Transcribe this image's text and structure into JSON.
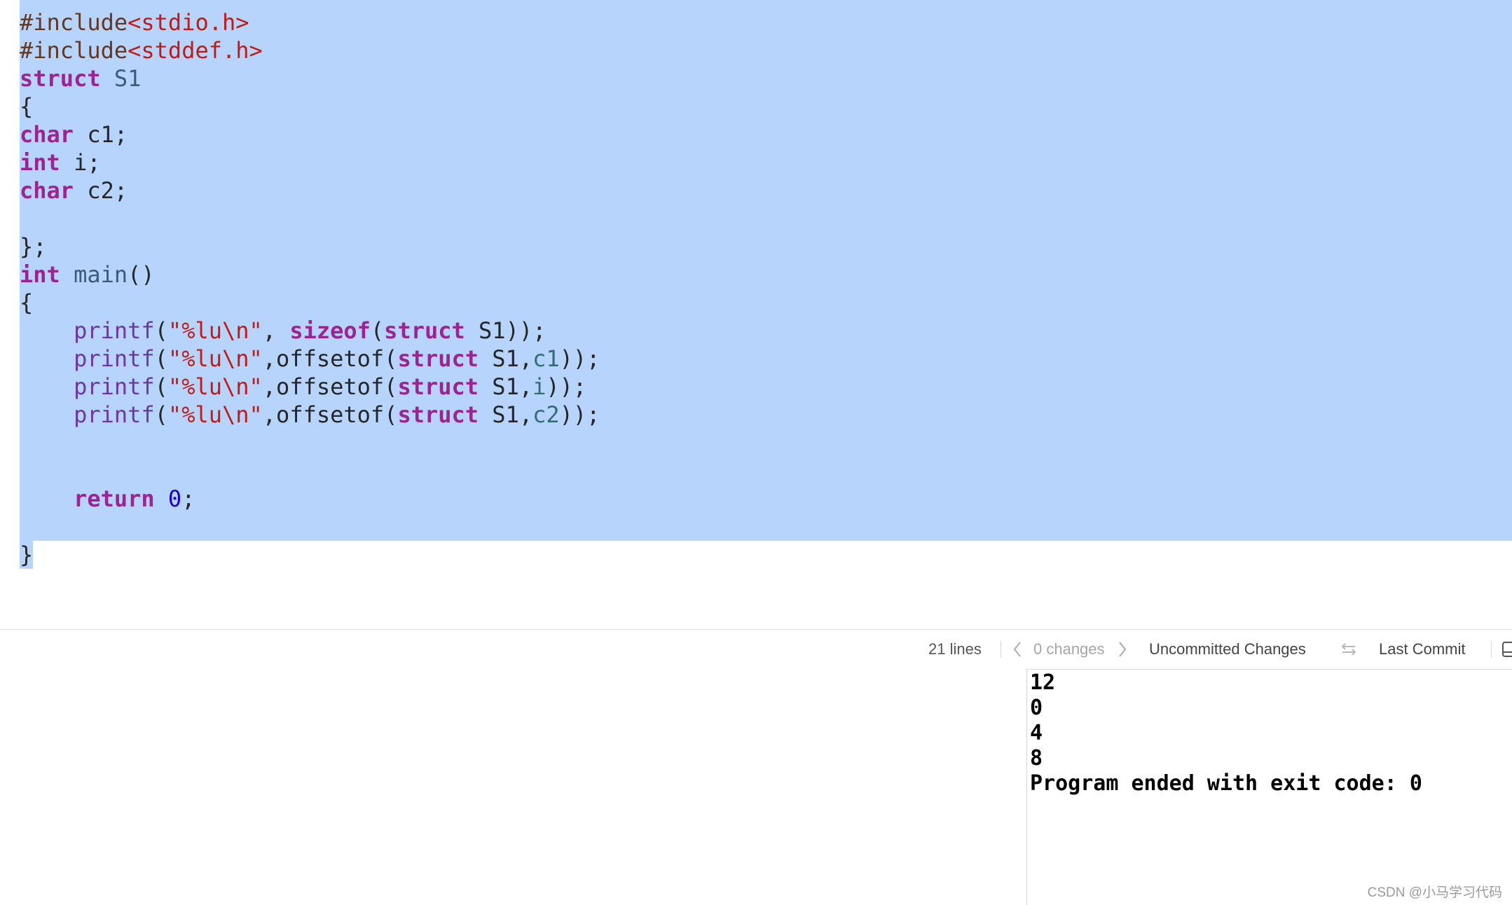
{
  "editor": {
    "lines": [
      {
        "tokens": [
          {
            "t": "#include",
            "c": "pp"
          },
          {
            "t": "<stdio.h>",
            "c": "str"
          }
        ]
      },
      {
        "tokens": [
          {
            "t": "#include",
            "c": "pp"
          },
          {
            "t": "<stddef.h>",
            "c": "str"
          }
        ]
      },
      {
        "tokens": [
          {
            "t": "struct",
            "c": "kw"
          },
          {
            "t": " "
          },
          {
            "t": "S1",
            "c": "type"
          }
        ]
      },
      {
        "tokens": [
          {
            "t": "{"
          }
        ]
      },
      {
        "tokens": [
          {
            "t": "char",
            "c": "kw"
          },
          {
            "t": " c1;"
          }
        ]
      },
      {
        "tokens": [
          {
            "t": "int",
            "c": "kw"
          },
          {
            "t": " i;"
          }
        ]
      },
      {
        "tokens": [
          {
            "t": "char",
            "c": "kw"
          },
          {
            "t": " c2;"
          }
        ]
      },
      {
        "tokens": []
      },
      {
        "tokens": [
          {
            "t": "};"
          }
        ]
      },
      {
        "tokens": [
          {
            "t": "int",
            "c": "kw"
          },
          {
            "t": " "
          },
          {
            "t": "main",
            "c": "type"
          },
          {
            "t": "()"
          }
        ]
      },
      {
        "tokens": [
          {
            "t": "{"
          }
        ]
      },
      {
        "tokens": [
          {
            "t": "    "
          },
          {
            "t": "printf",
            "c": "fn"
          },
          {
            "t": "("
          },
          {
            "t": "\"%lu\\n\"",
            "c": "str"
          },
          {
            "t": ", "
          },
          {
            "t": "sizeof",
            "c": "kw"
          },
          {
            "t": "("
          },
          {
            "t": "struct",
            "c": "kw"
          },
          {
            "t": " S1));"
          }
        ]
      },
      {
        "tokens": [
          {
            "t": "    "
          },
          {
            "t": "printf",
            "c": "fn"
          },
          {
            "t": "("
          },
          {
            "t": "\"%lu\\n\"",
            "c": "str"
          },
          {
            "t": ",offsetof("
          },
          {
            "t": "struct",
            "c": "kw"
          },
          {
            "t": " S1,"
          },
          {
            "t": "c1",
            "c": "mem"
          },
          {
            "t": "));"
          }
        ]
      },
      {
        "tokens": [
          {
            "t": "    "
          },
          {
            "t": "printf",
            "c": "fn"
          },
          {
            "t": "("
          },
          {
            "t": "\"%lu\\n\"",
            "c": "str"
          },
          {
            "t": ",offsetof("
          },
          {
            "t": "struct",
            "c": "kw"
          },
          {
            "t": " S1,"
          },
          {
            "t": "i",
            "c": "mem"
          },
          {
            "t": "));"
          }
        ]
      },
      {
        "tokens": [
          {
            "t": "    "
          },
          {
            "t": "printf",
            "c": "fn"
          },
          {
            "t": "("
          },
          {
            "t": "\"%lu\\n\"",
            "c": "str"
          },
          {
            "t": ",offsetof("
          },
          {
            "t": "struct",
            "c": "kw"
          },
          {
            "t": " S1,"
          },
          {
            "t": "c2",
            "c": "mem"
          },
          {
            "t": "));"
          }
        ]
      },
      {
        "tokens": []
      },
      {
        "tokens": []
      },
      {
        "tokens": [
          {
            "t": "    "
          },
          {
            "t": "return",
            "c": "kw"
          },
          {
            "t": " "
          },
          {
            "t": "0",
            "c": "num"
          },
          {
            "t": ";"
          }
        ]
      },
      {
        "tokens": []
      },
      {
        "tokens": [
          {
            "t": "}"
          }
        ]
      }
    ]
  },
  "statusbar": {
    "line_count": "21 lines",
    "changes": "0 changes",
    "uncommitted": "Uncommitted Changes",
    "last_commit": "Last Commit",
    "prev_icon": "chevron-left-icon",
    "next_icon": "chevron-right-icon",
    "compare_icon": "swap-arrows-icon"
  },
  "console": {
    "output": [
      "12",
      "0",
      "4",
      "8",
      "Program ended with exit code: 0"
    ]
  },
  "watermark": "CSDN @小马学习代码",
  "colors": {
    "selection": "#b7d5fc",
    "keyword": "#9b2393",
    "string": "#c41a16",
    "number": "#1c00cf",
    "type": "#3a5c78",
    "function": "#6c36a9",
    "member": "#326d74",
    "preprocessor": "#643820"
  }
}
